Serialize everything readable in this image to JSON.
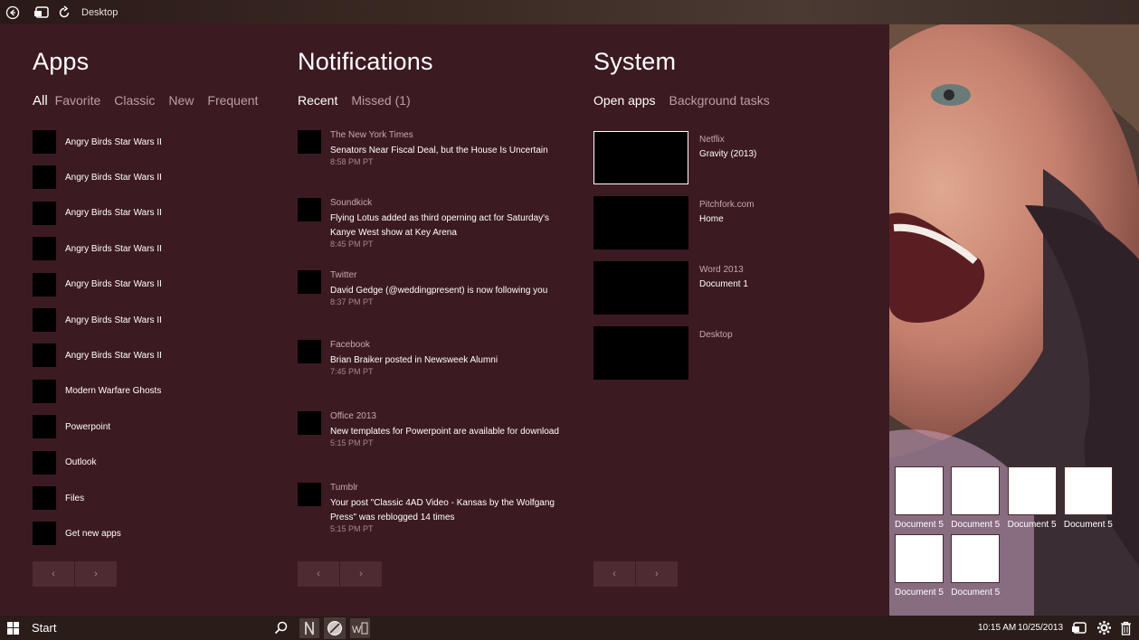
{
  "window": {
    "title": "Desktop"
  },
  "apps": {
    "heading": "Apps",
    "tabs": [
      "All",
      "Favorite",
      "Classic",
      "New",
      "Frequent"
    ],
    "items": [
      "Angry Birds Star Wars II",
      "Angry Birds Star Wars II",
      "Angry Birds Star Wars II",
      "Angry Birds Star Wars II",
      "Angry Birds Star Wars II",
      "Angry Birds Star Wars II",
      "Angry Birds Star Wars II",
      "Modern Warfare Ghosts",
      "Powerpoint",
      "Outlook",
      "Files",
      "Get new apps"
    ]
  },
  "notifications": {
    "heading": "Notifications",
    "tabs": [
      "Recent",
      "Missed (1)"
    ],
    "items": [
      {
        "source": "The New York Times",
        "message": "Senators Near Fiscal Deal, but the House Is Uncertain",
        "time": "8:58 PM PT"
      },
      {
        "source": "Soundkick",
        "message": "Flying Lotus added as third operning act for Saturday's Kanye West show at Key Arena",
        "time": "8:45 PM PT"
      },
      {
        "source": "Twitter",
        "message": "David Gedge (@weddingpresent) is now following you",
        "time": "8:37 PM PT"
      },
      {
        "source": "Facebook",
        "message": "Brian Braiker posted in Newsweek Alumni",
        "time": "7:45 PM PT"
      },
      {
        "source": "Office 2013",
        "message": "New templates for Powerpoint are available for download",
        "time": "5:15 PM PT"
      },
      {
        "source": "Tumblr",
        "message": "Your post \"Classic 4AD Video - Kansas by the Wolfgang Press\" was reblogged 14 times",
        "time": "5:15 PM PT"
      }
    ]
  },
  "system": {
    "heading": "System",
    "tabs": [
      "Open apps",
      "Background tasks"
    ],
    "items": [
      {
        "source": "Netflix",
        "subtitle": "Gravity (2013)"
      },
      {
        "source": "Pitchfork.com",
        "subtitle": "Home"
      },
      {
        "source": "Word 2013",
        "subtitle": "Document 1"
      },
      {
        "source": "Desktop",
        "subtitle": ""
      }
    ]
  },
  "documents": [
    "Document 5",
    "Document 5",
    "Document 5",
    "Document 5",
    "Document 5",
    "Document 5"
  ],
  "pager": {
    "prev": "‹",
    "next": "›"
  },
  "taskbar": {
    "start_label": "Start",
    "time": "10:15 AM",
    "date": "10/25/2013"
  },
  "colors": {
    "panel": "#3c1a22",
    "accent_text": "#c8a8b0"
  }
}
